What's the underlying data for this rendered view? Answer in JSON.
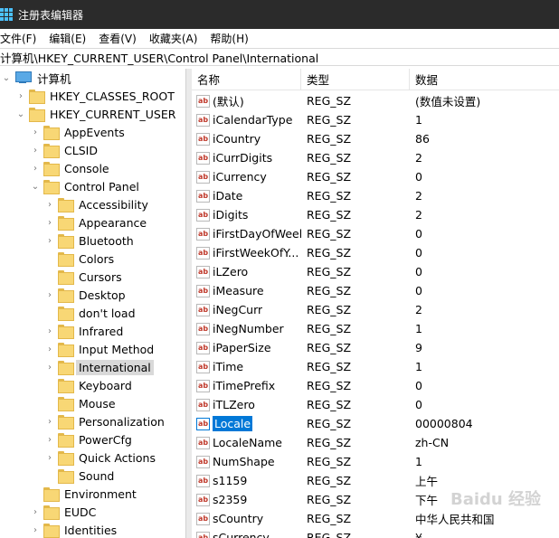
{
  "window": {
    "title": "注册表编辑器"
  },
  "menu": [
    "文件(F)",
    "编辑(E)",
    "查看(V)",
    "收藏夹(A)",
    "帮助(H)"
  ],
  "address": "计算机\\HKEY_CURRENT_USER\\Control Panel\\International",
  "tree": [
    {
      "label": "计算机",
      "kind": "pc",
      "expanded": true
    },
    {
      "label": "HKEY_CLASSES_ROOT",
      "kind": "folder",
      "expanded": false
    },
    {
      "label": "HKEY_CURRENT_USER",
      "kind": "folder",
      "expanded": true
    },
    {
      "label": "AppEvents",
      "kind": "folder",
      "expanded": false
    },
    {
      "label": "CLSID",
      "kind": "folder",
      "expanded": false
    },
    {
      "label": "Console",
      "kind": "folder",
      "expanded": false
    },
    {
      "label": "Control Panel",
      "kind": "folder",
      "expanded": true
    },
    {
      "label": "Accessibility",
      "kind": "folder",
      "expanded": false
    },
    {
      "label": "Appearance",
      "kind": "folder",
      "expanded": false
    },
    {
      "label": "Bluetooth",
      "kind": "folder",
      "expanded": false
    },
    {
      "label": "Colors",
      "kind": "folder",
      "expanded": null
    },
    {
      "label": "Cursors",
      "kind": "folder",
      "expanded": null
    },
    {
      "label": "Desktop",
      "kind": "folder",
      "expanded": false
    },
    {
      "label": "don't load",
      "kind": "folder",
      "expanded": null
    },
    {
      "label": "Infrared",
      "kind": "folder",
      "expanded": false
    },
    {
      "label": "Input Method",
      "kind": "folder",
      "expanded": false
    },
    {
      "label": "International",
      "kind": "folder",
      "expanded": false,
      "selected": true
    },
    {
      "label": "Keyboard",
      "kind": "folder",
      "expanded": null
    },
    {
      "label": "Mouse",
      "kind": "folder",
      "expanded": null
    },
    {
      "label": "Personalization",
      "kind": "folder",
      "expanded": false
    },
    {
      "label": "PowerCfg",
      "kind": "folder",
      "expanded": false
    },
    {
      "label": "Quick Actions",
      "kind": "folder",
      "expanded": false
    },
    {
      "label": "Sound",
      "kind": "folder",
      "expanded": null
    },
    {
      "label": "Environment",
      "kind": "folder",
      "expanded": null
    },
    {
      "label": "EUDC",
      "kind": "folder",
      "expanded": false
    },
    {
      "label": "Identities",
      "kind": "folder",
      "expanded": false
    }
  ],
  "columns": {
    "name": "名称",
    "type": "类型",
    "data": "数据"
  },
  "values": [
    {
      "name": "(默认)",
      "type": "REG_SZ",
      "data": "(数值未设置)"
    },
    {
      "name": "iCalendarType",
      "type": "REG_SZ",
      "data": "1"
    },
    {
      "name": "iCountry",
      "type": "REG_SZ",
      "data": "86"
    },
    {
      "name": "iCurrDigits",
      "type": "REG_SZ",
      "data": "2"
    },
    {
      "name": "iCurrency",
      "type": "REG_SZ",
      "data": "0"
    },
    {
      "name": "iDate",
      "type": "REG_SZ",
      "data": "2"
    },
    {
      "name": "iDigits",
      "type": "REG_SZ",
      "data": "2"
    },
    {
      "name": "iFirstDayOfWeek",
      "type": "REG_SZ",
      "data": "0"
    },
    {
      "name": "iFirstWeekOfY...",
      "type": "REG_SZ",
      "data": "0"
    },
    {
      "name": "iLZero",
      "type": "REG_SZ",
      "data": "0"
    },
    {
      "name": "iMeasure",
      "type": "REG_SZ",
      "data": "0"
    },
    {
      "name": "iNegCurr",
      "type": "REG_SZ",
      "data": "2"
    },
    {
      "name": "iNegNumber",
      "type": "REG_SZ",
      "data": "1"
    },
    {
      "name": "iPaperSize",
      "type": "REG_SZ",
      "data": "9"
    },
    {
      "name": "iTime",
      "type": "REG_SZ",
      "data": "1"
    },
    {
      "name": "iTimePrefix",
      "type": "REG_SZ",
      "data": "0"
    },
    {
      "name": "iTLZero",
      "type": "REG_SZ",
      "data": "0"
    },
    {
      "name": "Locale",
      "type": "REG_SZ",
      "data": "00000804",
      "selected": true
    },
    {
      "name": "LocaleName",
      "type": "REG_SZ",
      "data": "zh-CN"
    },
    {
      "name": "NumShape",
      "type": "REG_SZ",
      "data": "1"
    },
    {
      "name": "s1159",
      "type": "REG_SZ",
      "data": "上午"
    },
    {
      "name": "s2359",
      "type": "REG_SZ",
      "data": "下午"
    },
    {
      "name": "sCountry",
      "type": "REG_SZ",
      "data": "中华人民共和国"
    },
    {
      "name": "sCurrency",
      "type": "REG_SZ",
      "data": "¥"
    }
  ],
  "value_icon": "ab",
  "colors": {
    "titlebar": "#2b2b2b",
    "selection": "#0078d7",
    "folder": "#f8d775"
  }
}
